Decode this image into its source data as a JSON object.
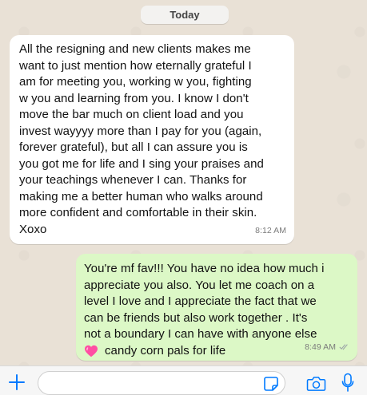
{
  "date_label": "Today",
  "messages": [
    {
      "direction": "incoming",
      "text": "All the resigning and new clients makes me\nwant to just mention how eternally grateful I\nam for meeting you, working w you, fighting\nw you and learning from you. I know I don't\nmove the bar much on client load and you\ninvest wayyyy more than I pay for you (again,\nforever grateful), but all I can assure you is\nyou got me for life and I sing your praises and\nyour teachings whenever I can. Thanks for\nmaking me a better human who walks around\nmore confident and comfortable in their skin.\nXoxo",
      "time": "8:12 AM"
    },
    {
      "direction": "outgoing",
      "text": "You're mf fav!!! You have no idea how much i\nappreciate you also. You let me coach on a\nlevel I love and I appreciate the fact that we\ncan be friends but also work together . It's\nnot a boundary I can have with anyone else",
      "last_line": "candy corn pals for life",
      "time": "8:49 AM",
      "status_icon": "double-check-icon",
      "emoji_icon": "pink-heart-icon"
    }
  ],
  "input": {
    "value": "",
    "placeholder": ""
  },
  "icons": [
    "plus-icon",
    "sticker-icon",
    "camera-icon",
    "mic-icon"
  ],
  "colors": {
    "accent": "#007aff",
    "outgoing_bubble": "#dcf8c6",
    "incoming_bubble": "#ffffff",
    "chat_background": "#e9e1d6",
    "heart": "#ff4fa3"
  }
}
